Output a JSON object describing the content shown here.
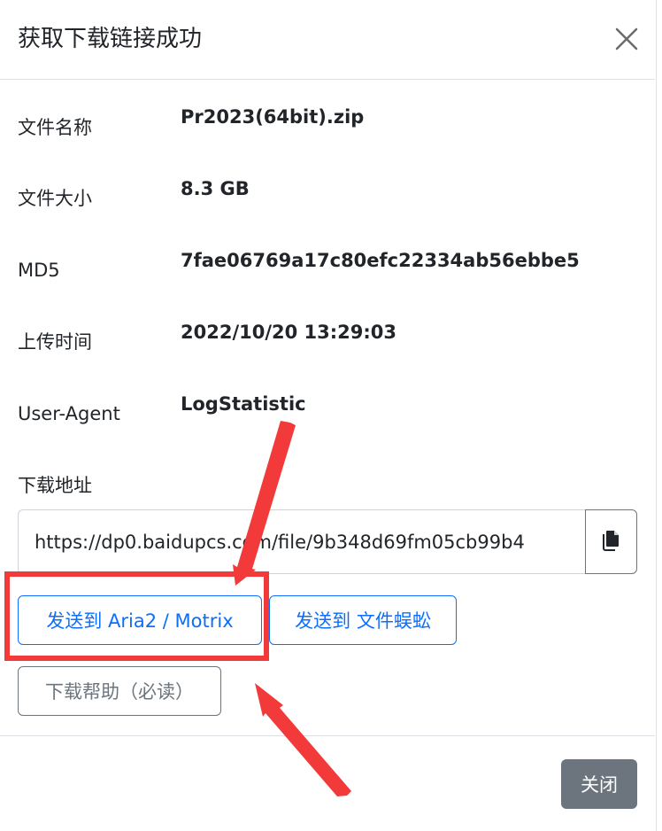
{
  "modal": {
    "title": "获取下载链接成功",
    "close_icon": "close-icon"
  },
  "info": {
    "file_name_label": "文件名称",
    "file_name_value": "Pr2023(64bit).zip",
    "file_size_label": "文件大小",
    "file_size_value": "8.3 GB",
    "md5_label": "MD5",
    "md5_value": "7fae06769a17c80efc22334ab56ebbe5",
    "upload_time_label": "上传时间",
    "upload_time_value": "2022/10/20 13:29:03",
    "user_agent_label": "User-Agent",
    "user_agent_value": "LogStatistic"
  },
  "download": {
    "label": "下载地址",
    "url": "https://dp0.baidupcs.com/file/9b348d69fm05cb99b4",
    "copy_icon": "copy-icon"
  },
  "actions": {
    "send_aria2": "发送到 Aria2 / Motrix",
    "send_wenjianwozhu": "发送到 文件蜈蚣",
    "help": "下载帮助（必读）"
  },
  "footer": {
    "close_label": "关闭"
  },
  "colors": {
    "primary": "#0d6efd",
    "secondary": "#6c757d",
    "annotation": "#f23a3a"
  }
}
